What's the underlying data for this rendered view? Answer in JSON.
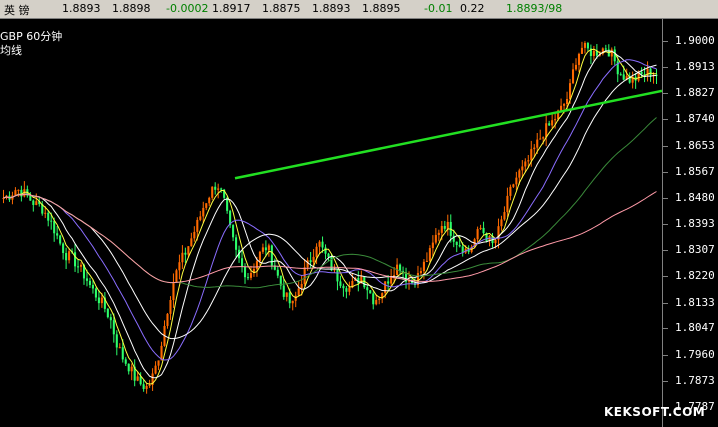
{
  "quote": {
    "name": "英  镑",
    "open": "1.8893",
    "prev": "1.8898",
    "change": "-0.0002",
    "high": "1.8917",
    "low": "1.8875",
    "last": "1.8893",
    "close": "1.8895",
    "change2": "-0.01",
    "pct": "0.22",
    "bidask": "1.8893/98"
  },
  "chart": {
    "symbol": "GBP  60分钟",
    "indicator": "均线",
    "watermark": "KEKSOFT.COM"
  },
  "colors": {
    "up": "#ff6a00",
    "down": "#2cff6a",
    "ma5": "#ffffff",
    "ma10": "#ffff40",
    "ma20": "#8a6dff",
    "ma30": "#ffffff",
    "ma60": "#3a8a3a",
    "ma120": "#ff9aa8",
    "trendline": "#22e022"
  },
  "price_axis": {
    "ticks": [
      "1.9000",
      "1.8913",
      "1.8827",
      "1.8740",
      "1.8653",
      "1.8567",
      "1.8480",
      "1.8393",
      "1.8307",
      "1.8220",
      "1.8133",
      "1.8047",
      "1.7960",
      "1.7873",
      "1.7787"
    ]
  },
  "chart_data": {
    "type": "line",
    "ylim": [
      1.775,
      1.905
    ],
    "trendline": {
      "x": [
        0.355,
        1.0
      ],
      "y": [
        1.8545,
        1.8835
      ]
    },
    "price_path": [
      1.848,
      1.849,
      1.851,
      1.85,
      1.848,
      1.846,
      1.845,
      1.842,
      1.838,
      1.833,
      1.829,
      1.828,
      1.825,
      1.822,
      1.818,
      1.815,
      1.812,
      1.808,
      1.8,
      1.795,
      1.792,
      1.788,
      1.786,
      1.785,
      1.79,
      1.798,
      1.81,
      1.82,
      1.826,
      1.83,
      1.835,
      1.84,
      1.846,
      1.85,
      1.853,
      1.848,
      1.838,
      1.83,
      1.825,
      1.822,
      1.826,
      1.83,
      1.832,
      1.826,
      1.82,
      1.815,
      1.812,
      1.818,
      1.824,
      1.828,
      1.834,
      1.83,
      1.826,
      1.822,
      1.82,
      1.818,
      1.82,
      1.822,
      1.818,
      1.814,
      1.816,
      1.82,
      1.824,
      1.826,
      1.822,
      1.82,
      1.822,
      1.826,
      1.83,
      1.836,
      1.84,
      1.838,
      1.834,
      1.832,
      1.83,
      1.834,
      1.838,
      1.835,
      1.832,
      1.838,
      1.845,
      1.852,
      1.856,
      1.858,
      1.862,
      1.866,
      1.87,
      1.872,
      1.875,
      1.878,
      1.882,
      1.893,
      1.898,
      1.897,
      1.896,
      1.897,
      1.898,
      1.895,
      1.89,
      1.888,
      1.887,
      1.888,
      1.889,
      1.89,
      1.889
    ]
  }
}
